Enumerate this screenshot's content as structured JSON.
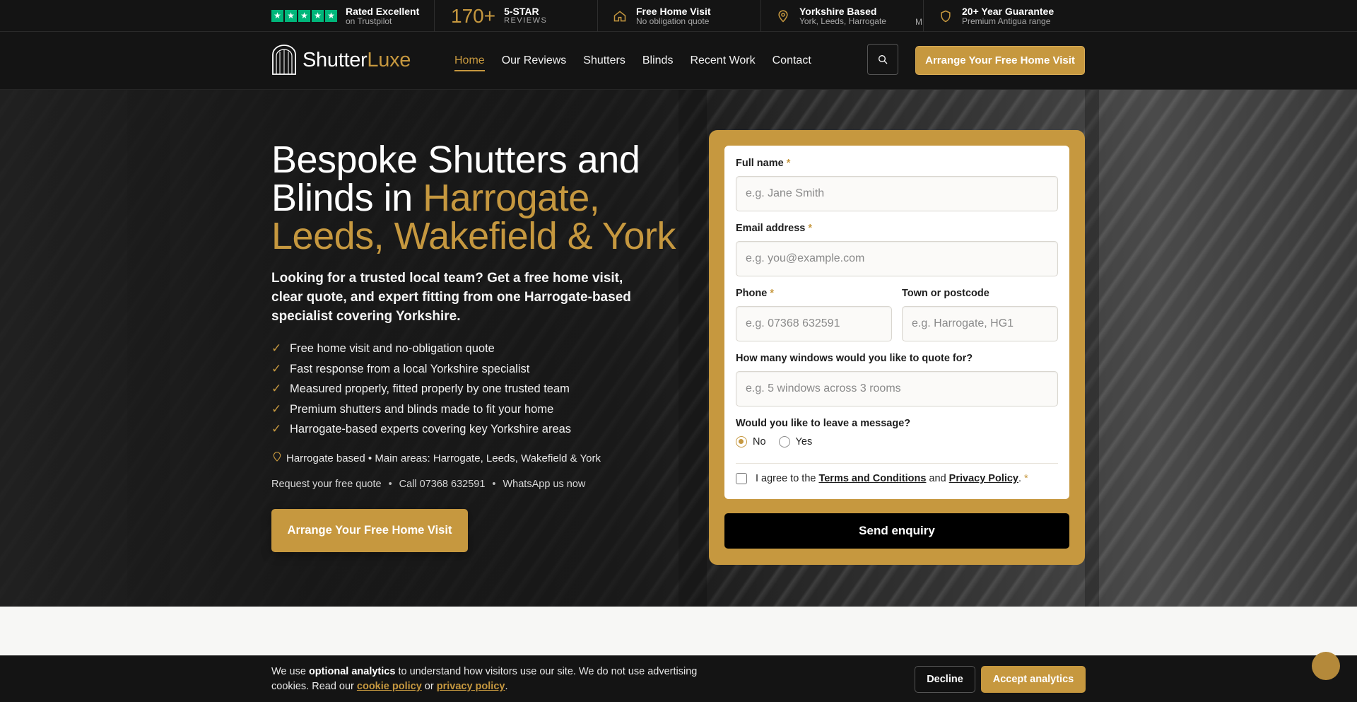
{
  "trustbar": {
    "trustpilot": {
      "title": "Rated Excellent",
      "sub": "on Trustpilot",
      "stars": [
        "★",
        "★",
        "★",
        "★",
        "★"
      ],
      "star_color": "#00b67a"
    },
    "reviews": {
      "number": "170+",
      "title": "5-STAR",
      "sub": "REVIEWS"
    },
    "home_visit": {
      "icon": "house-icon",
      "title": "Free Home Visit",
      "sub": "No obligation quote"
    },
    "local": {
      "icon": "map-pin-icon",
      "title": "Yorkshire Based",
      "sub": "York, Leeds, Harrogate"
    },
    "partial_text": "M",
    "guarantee": {
      "icon": "shield-icon",
      "title": "20+ Year Guarantee",
      "sub": "Premium Antigua range"
    }
  },
  "header": {
    "logo": {
      "part1": "Shutter",
      "part2": "Luxe"
    },
    "nav": [
      {
        "label": "Home",
        "active": true
      },
      {
        "label": "Our Reviews",
        "active": false
      },
      {
        "label": "Shutters",
        "active": false
      },
      {
        "label": "Blinds",
        "active": false
      },
      {
        "label": "Recent Work",
        "active": false
      },
      {
        "label": "Contact",
        "active": false
      }
    ],
    "search_icon": "search-icon",
    "cta_label": "Arrange Your Free Home Visit"
  },
  "hero": {
    "title_line1": "Bespoke Shutters and",
    "title_line2_plain": "Blinds in ",
    "title_line2_gold": "Harrogate,",
    "title_line3_gold": "Leeds, Wakefield & York",
    "lead": "Looking for a trusted local team? Get a free home visit, clear quote, and expert fitting from one Harrogate-based specialist covering Yorkshire.",
    "checks": [
      "Free home visit and no-obligation quote",
      "Fast response from a local Yorkshire specialist",
      "Measured properly, fitted properly by one trusted team",
      "Premium shutters and blinds made to fit your home",
      "Harrogate-based experts covering key Yorkshire areas"
    ],
    "location_line": "Harrogate based • Main areas: Harrogate, Leeds, Wakefield & York",
    "contact_links": [
      "Request your free quote",
      "Call 07368 632591",
      "WhatsApp us now"
    ],
    "contact_sep": "•",
    "cta_label": "Arrange Your Free Home Visit"
  },
  "form": {
    "full_name": {
      "label": "Full name",
      "placeholder": "e.g. Jane Smith",
      "value": ""
    },
    "email": {
      "label": "Email address",
      "placeholder": "e.g. you@example.com",
      "value": ""
    },
    "phone": {
      "label": "Phone",
      "placeholder": "e.g. 07368 632591",
      "value": ""
    },
    "town": {
      "label": "Town or postcode",
      "placeholder": "e.g. Harrogate, HG1",
      "value": ""
    },
    "windows": {
      "label": "How many windows would you like to quote for?",
      "placeholder": "e.g. 5 windows across 3 rooms",
      "value": ""
    },
    "message_question": "Would you like to leave a message?",
    "message_options": [
      {
        "label": "No",
        "checked": true
      },
      {
        "label": "Yes",
        "checked": false
      }
    ],
    "agree": {
      "prefix": "I agree to the",
      "terms": "Terms and Conditions",
      "and": "and",
      "privacy": "Privacy Policy",
      "suffix": ".",
      "checked": false
    },
    "required_mark": "*",
    "submit_label": "Send enquiry"
  },
  "cookie": {
    "text_before": "We use ",
    "text_bold": "optional analytics",
    "text_after": " to understand how visitors use our site. We do not use advertising cookies. Read our ",
    "cookie_policy": "cookie policy",
    "or": " or ",
    "privacy_policy": "privacy policy",
    "end": ".",
    "decline_label": "Decline",
    "accept_label": "Accept analytics"
  },
  "colors": {
    "accent": "#c6983f",
    "dark": "#141414",
    "trustpilot": "#00b67a"
  }
}
